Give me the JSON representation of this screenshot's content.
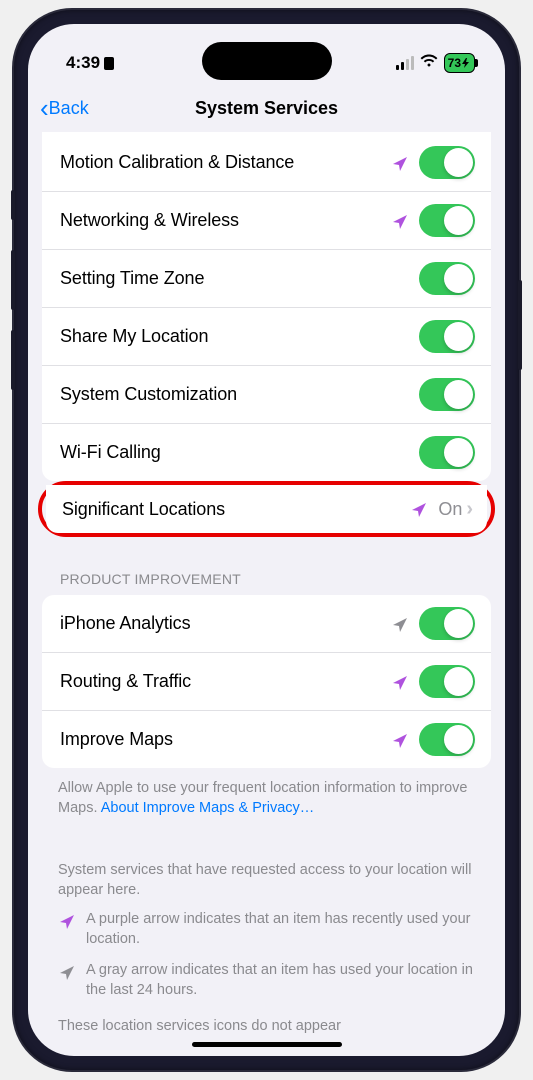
{
  "status": {
    "time": "4:39",
    "battery": "73"
  },
  "nav": {
    "back": "Back",
    "title": "System Services"
  },
  "group1": {
    "items": [
      {
        "label": "Motion Calibration & Distance",
        "arrow": "purple"
      },
      {
        "label": "Networking & Wireless",
        "arrow": "purple"
      },
      {
        "label": "Setting Time Zone",
        "arrow": null
      },
      {
        "label": "Share My Location",
        "arrow": null
      },
      {
        "label": "System Customization",
        "arrow": null
      },
      {
        "label": "Wi-Fi Calling",
        "arrow": null
      }
    ]
  },
  "significant": {
    "label": "Significant Locations",
    "value": "On",
    "arrow": "purple"
  },
  "section2": {
    "header": "Product Improvement",
    "items": [
      {
        "label": "iPhone Analytics",
        "arrow": "gray"
      },
      {
        "label": "Routing & Traffic",
        "arrow": "purple"
      },
      {
        "label": "Improve Maps",
        "arrow": "purple"
      }
    ],
    "footer": "Allow Apple to use your frequent location information to improve Maps. ",
    "footer_link": "About Improve Maps & Privacy…"
  },
  "info": {
    "text1": "System services that have requested access to your location will appear here.",
    "legend_purple": "A purple arrow indicates that an item has recently used your location.",
    "legend_gray": "A gray arrow indicates that an item has used your location in the last 24 hours.",
    "text2": "These location services icons do not appear"
  },
  "colors": {
    "purple": "#af52de",
    "gray": "#8e8e93",
    "green": "#34c759"
  }
}
